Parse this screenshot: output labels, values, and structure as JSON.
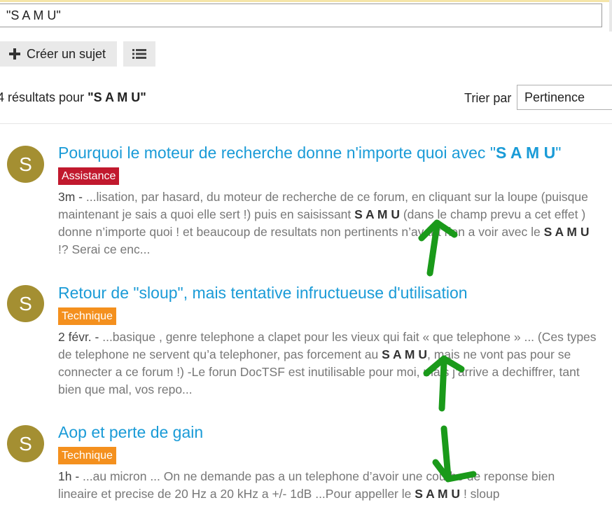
{
  "search": {
    "value": "\"S A M U\""
  },
  "toolbar": {
    "create_label": "Créer un sujet"
  },
  "results": {
    "count_prefix": "4 résultats pour ",
    "query": "\"S A M U\"",
    "sort_label": "Trier par",
    "sort_value": "Pertinence"
  },
  "items": [
    {
      "avatar": "S",
      "title_text": "Pourquoi le moteur de recherche donne n'importe quoi avec \"",
      "title_strong": "S A M U",
      "title_end": "\"",
      "badge": "Assistance",
      "date": "3m - ",
      "excerpt_1": "...lisation, par hasard, du moteur de recherche de ce forum, en cliquant sur la loupe (puisque maintenant je sais a quoi elle sert !) puis en saisissant ",
      "strong_1": "S A M U",
      "excerpt_2": " (dans le champ prevu a cet effet ) donne n’importe quoi ! et beaucoup de resultats non pertinents n’ayant rien a voir avec le ",
      "strong_2": "S A M U",
      "excerpt_3": " !? Serai ce enc..."
    },
    {
      "avatar": "S",
      "title_text": "Retour de \"sloup\", mais tentative infructueuse d'utilisation",
      "badge": "Technique",
      "date": "2 févr. - ",
      "excerpt_1": "...basique , genre telephone a clapet pour les vieux qui fait « que telephone » ... (Ces types de telephone ne servent qu’a telephoner, pas forcement au ",
      "strong_1": "S A M U",
      "excerpt_2": ", mais ne vont pas pour se connecter a ce forum !) -Le forun DocTSF est inutilisable pour moi, mais j’arrive a dechiffrer, tant bien que mal, vos repo..."
    },
    {
      "avatar": "S",
      "title_text": "Aop et perte de gain",
      "badge": "Technique",
      "date": "1h - ",
      "excerpt_1": "...au micron ... On ne demande pas a un telephone d’avoir une courbe de reponse bien lineaire et precise de 20 Hz a 20 kHz a +/- 1dB ...Pour appeller le ",
      "strong_1": "S A M U",
      "excerpt_2": " ! sloup"
    }
  ],
  "colors": {
    "link": "#1a9bd7",
    "badge_assistance": "#c1192e",
    "badge_technique": "#f4901e",
    "avatar": "#a48f32",
    "annotation_arrow": "#1a9a1a"
  }
}
